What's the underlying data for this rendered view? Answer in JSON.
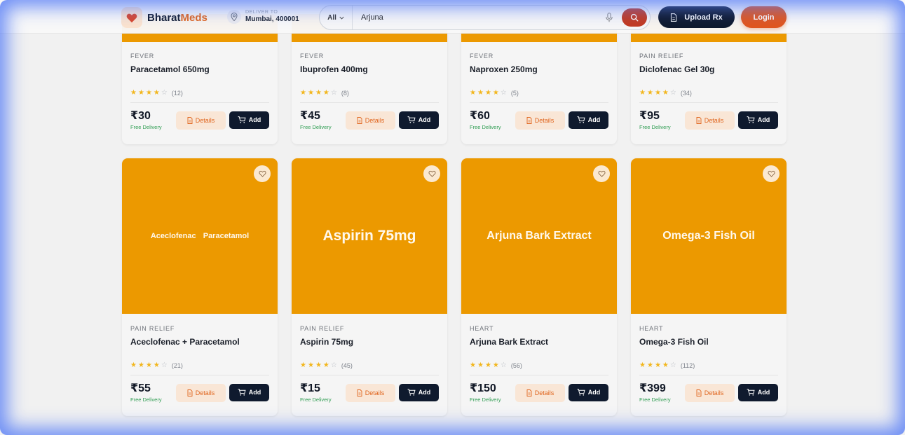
{
  "header": {
    "brand_part1": "Bharat",
    "brand_part2": "Meds",
    "deliver_label": "DELIVER TO",
    "deliver_location": "Mumbai, 400001",
    "search_category": "All",
    "search_value": "Arjuna",
    "upload_label": "Upload Rx",
    "login_label": "Login"
  },
  "colors": {
    "accent": "#e0561f",
    "navy": "#0f1a2e",
    "hero": "#ec9900",
    "star": "#f2b61d",
    "free_delivery": "#2f9d52"
  },
  "labels": {
    "details": "Details",
    "add": "Add",
    "free_delivery": "Free Delivery"
  },
  "products_row1": [
    {
      "category": "FEVER",
      "name": "Paracetamol 650mg",
      "rating": 4,
      "reviews": "(12)",
      "price": "₹30"
    },
    {
      "category": "FEVER",
      "name": "Ibuprofen 400mg",
      "rating": 4,
      "reviews": "(8)",
      "price": "₹45"
    },
    {
      "category": "FEVER",
      "name": "Naproxen 250mg",
      "rating": 4,
      "reviews": "(5)",
      "price": "₹60"
    },
    {
      "category": "PAIN RELIEF",
      "name": "Diclofenac Gel 30g",
      "rating": 4,
      "reviews": "(34)",
      "price": "₹95"
    }
  ],
  "products_row2": [
    {
      "image_text": "Aceclofenac  Paracetamol",
      "category": "PAIN RELIEF",
      "name": "Aceclofenac + Paracetamol",
      "rating": 4,
      "reviews": "(21)",
      "price": "₹55"
    },
    {
      "image_text": "Aspirin 75mg",
      "category": "PAIN RELIEF",
      "name": "Aspirin 75mg",
      "rating": 4,
      "reviews": "(45)",
      "price": "₹15"
    },
    {
      "image_text": "Arjuna Bark Extract",
      "category": "HEART",
      "name": "Arjuna Bark Extract",
      "rating": 4,
      "reviews": "(56)",
      "price": "₹150"
    },
    {
      "image_text": "Omega-3 Fish Oil",
      "category": "HEART",
      "name": "Omega-3 Fish Oil",
      "rating": 4,
      "reviews": "(112)",
      "price": "₹399"
    }
  ],
  "icons": {
    "logo": "heart-icon",
    "location": "map-pin-icon",
    "dropdown": "chevron-down-icon",
    "mic": "microphone-icon",
    "search": "search-icon",
    "upload": "document-icon",
    "wishlist": "heart-outline-icon",
    "details": "document-icon",
    "add": "cart-icon",
    "star": "star-icon"
  }
}
